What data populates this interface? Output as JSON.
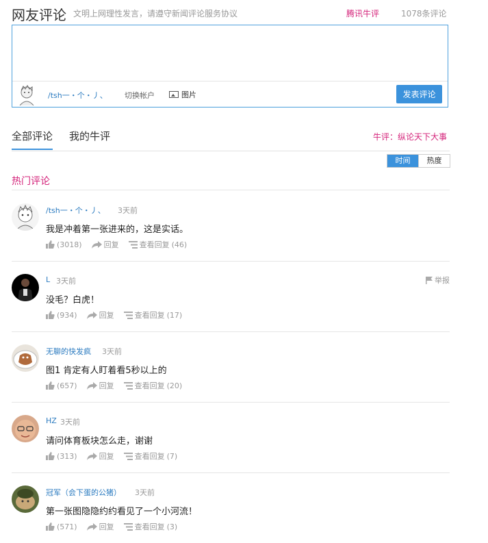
{
  "header": {
    "title": "网友评论",
    "subtitle": "文明上网理性发言，请遵守新闻评论服务协议",
    "tencent_link": "腾讯牛评",
    "count": "1078条评论"
  },
  "editor": {
    "placeholder": "",
    "user_name": "/tsh一・个・丿、",
    "switch_account": "切换帐户",
    "image_label": "图片",
    "post_button": "发表评论"
  },
  "tabs": {
    "all": "全部评论",
    "mine": "我的牛评",
    "right_link": "牛评：纵论天下大事"
  },
  "sort": {
    "time": "时间",
    "hot": "热度"
  },
  "section_title": "热门评论",
  "reply_label": "回复",
  "view_replies_label": "查看回复",
  "report_label": "举报",
  "comments": [
    {
      "user": "/tsh一・个・丿、",
      "time": "3天前",
      "text": "我是冲着第一张进来的，这是实话。",
      "likes": "(3018)",
      "replies": "(46)"
    },
    {
      "user": "L",
      "time": "3天前",
      "text": "没毛？白虎！",
      "likes": "(934)",
      "replies": "(17)"
    },
    {
      "user": "无聊的快发疯",
      "time": "3天前",
      "text": "图1 肯定有人盯着看5秒以上的",
      "likes": "(657)",
      "replies": "(20)"
    },
    {
      "user": "HZ",
      "time": "3天前",
      "text": "请问体育板块怎么走，谢谢",
      "likes": "(313)",
      "replies": "(7)"
    },
    {
      "user": "冠军（会下蛋的公猪）",
      "time": "3天前",
      "text": "第一张图隐隐约约看见了一个小河流！",
      "likes": "(571)",
      "replies": "(3)"
    }
  ],
  "colors": {
    "accent": "#3b92dc",
    "pink": "#d4237a",
    "link": "#2b7bc0"
  }
}
